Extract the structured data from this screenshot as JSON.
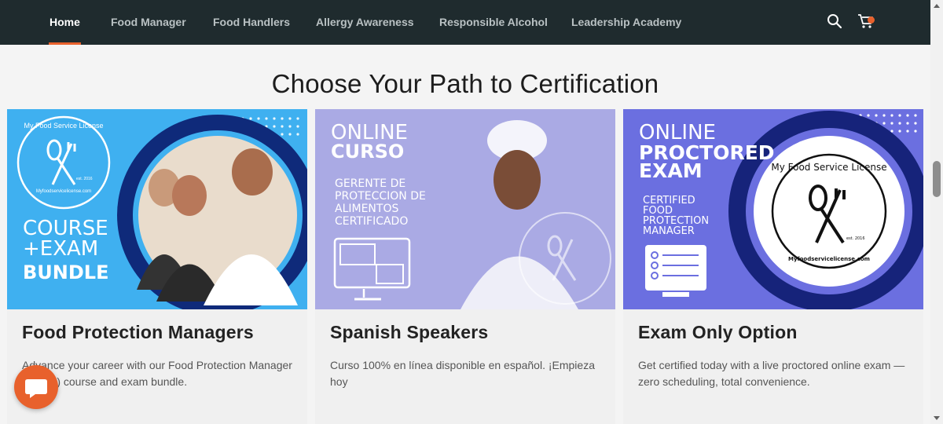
{
  "nav": {
    "items": [
      {
        "label": "Home",
        "active": true
      },
      {
        "label": "Food Manager",
        "active": false
      },
      {
        "label": "Food Handlers",
        "active": false
      },
      {
        "label": "Allergy Awareness",
        "active": false
      },
      {
        "label": "Responsible Alcohol",
        "active": false
      },
      {
        "label": "Leadership Academy",
        "active": false
      }
    ],
    "search_icon": "search-icon",
    "cart_icon": "cart-icon"
  },
  "colors": {
    "nav_bg": "#1f2b2e",
    "accent": "#e8612c",
    "card1_bg": "#3fb0f0",
    "card2_bg": "#9fa3e8",
    "card3_bg": "#6b6fe0"
  },
  "page": {
    "heading": "Choose Your Path to Certification"
  },
  "cards": [
    {
      "title": "Food Protection Managers",
      "description": "Advance your career with our Food Protection Manager (CFPM) course and exam bundle.",
      "image": {
        "badge_lines": [
          "My Food Service License",
          "Myfoodservicelicense.com",
          "est. 2016"
        ],
        "line1": "COURSE",
        "line2": "+EXAM",
        "line3": "BUNDLE"
      }
    },
    {
      "title": "Spanish Speakers",
      "description": "Curso 100% en línea disponible en español. ¡Empieza hoy",
      "image": {
        "line1": "ONLINE",
        "line2": "CURSO",
        "sub": [
          "GERENTE DE",
          "PROTECCION DE",
          "ALIMENTOS",
          "CERTIFICADO"
        ]
      }
    },
    {
      "title": "Exam Only Option",
      "description": "Get certified today with a live proctored online exam — zero scheduling, total convenience.",
      "image": {
        "line1": "ONLINE",
        "line2": "PROCTORED",
        "line3": "EXAM",
        "sub": [
          "CERTIFIED",
          "FOOD",
          "PROTECTION",
          "MANAGER"
        ],
        "badge_lines": [
          "My Food Service License",
          "Myfoodservicelicense.com",
          "est. 2016"
        ]
      }
    }
  ],
  "chat": {
    "icon": "chat-bubble-icon"
  }
}
